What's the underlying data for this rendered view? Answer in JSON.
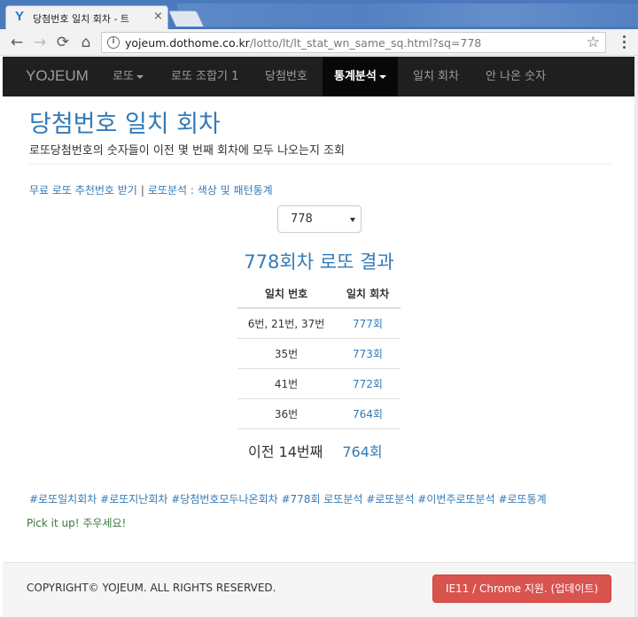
{
  "browser": {
    "tab_title": "당첨번호 일치 회차 - 트",
    "url_host": "yojeum.dothome.co.kr",
    "url_path": "/lotto/lt/lt_stat_wn_same_sq.html?sq=778"
  },
  "navbar": {
    "brand": "YOJEUM",
    "items": [
      {
        "label": "로또",
        "dropdown": true
      },
      {
        "label": "로또 조합기 1",
        "dropdown": false
      },
      {
        "label": "당첨번호",
        "dropdown": false
      },
      {
        "label": "통계분석",
        "dropdown": true,
        "active": true
      },
      {
        "label": "일치 회차",
        "dropdown": false
      },
      {
        "label": "안 나온 숫자",
        "dropdown": false
      }
    ]
  },
  "page": {
    "title": "당첨번호 일치 회차",
    "description": "로또당첨번호의 숫자들이 이전 몇 번째 회차에 모두 나오는지 조회",
    "link1": "무료 로또 추천번호 받기",
    "link_sep": "|",
    "link2": "로또분석 : 색상 및 패턴통계",
    "select_value": "778",
    "result_title": "778회차 로또 결과"
  },
  "table": {
    "headers": [
      "일치 번호",
      "일치 회차"
    ],
    "rows": [
      {
        "numbers": "6번, 21번, 37번",
        "round": "777회"
      },
      {
        "numbers": "35번",
        "round": "773회"
      },
      {
        "numbers": "41번",
        "round": "772회"
      },
      {
        "numbers": "36번",
        "round": "764회"
      }
    ]
  },
  "summary": {
    "label": "이전 14번째",
    "round": "764회"
  },
  "tags": "#로또일치회차 #로또지난회차 #당첨번호모두나온회차 #778회 로또분석 #로또분석 #이번주로또분석 #로또통계",
  "pick_text": "Pick it up! 주우세요!",
  "footer": {
    "copyright": "COPYRIGHT© YOJEUM. ALL RIGHTS RESERVED.",
    "update_button": "IE11 / Chrome 지원. (업데이트)"
  },
  "colors": {
    "link": "#337ab7",
    "navbar_bg": "#1f1f1f",
    "nav_active_bg": "#080808",
    "button_danger": "#d9534f",
    "pick_text": "#3c763d"
  },
  "icons": [
    "favicon-y-icon",
    "close-icon",
    "back-arrow-icon",
    "forward-arrow-icon",
    "reload-icon",
    "home-icon",
    "page-info-icon",
    "star-icon",
    "menu-dots-icon",
    "caret-down-icon"
  ]
}
